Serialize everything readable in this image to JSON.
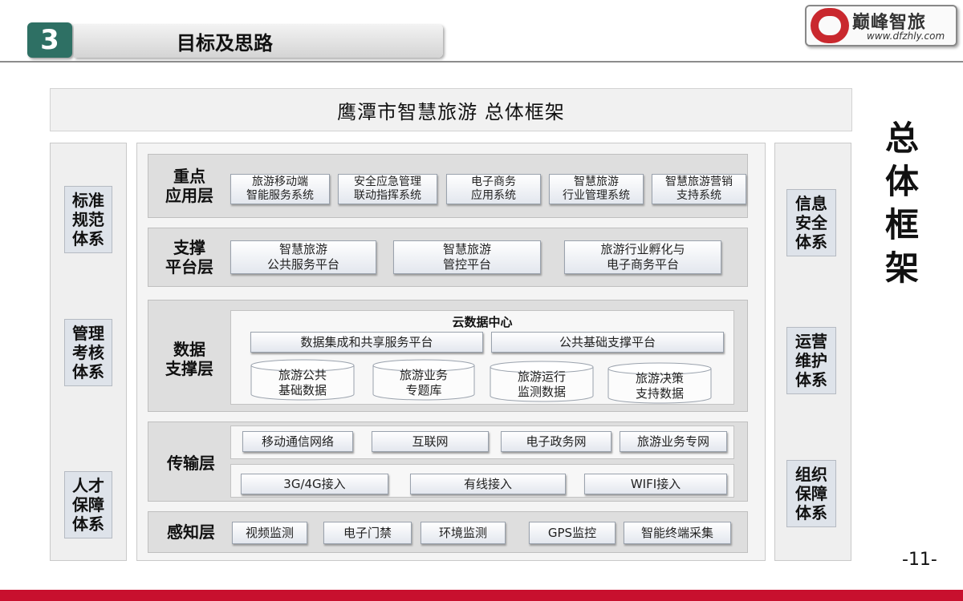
{
  "header": {
    "section_number": "3",
    "section_title": "目标及思路",
    "logo_text": "巅峰智旅",
    "logo_url": "www.dfzhly.com"
  },
  "diagram": {
    "title": "鹰潭市智慧旅游  总体框架",
    "left_pillars": [
      "标准\n规范\n体系",
      "管理\n考核\n体系",
      "人才\n保障\n体系"
    ],
    "right_pillars": [
      "信息\n安全\n体系",
      "运营\n维护\n体系",
      "组织\n保障\n体系"
    ],
    "layers": {
      "application": {
        "label": "重点\n应用层",
        "items": [
          "旅游移动端\n智能服务系统",
          "安全应急管理\n联动指挥系统",
          "电子商务\n应用系统",
          "智慧旅游\n行业管理系统",
          "智慧旅游营销\n支持系统"
        ]
      },
      "platform": {
        "label": "支撑\n平台层",
        "items": [
          "智慧旅游\n公共服务平台",
          "智慧旅游\n管控平台",
          "旅游行业孵化与\n电子商务平台"
        ]
      },
      "data": {
        "label": "数据\n支撑层",
        "cloud_title": "云数据中心",
        "platforms": [
          "数据集成和共享服务平台",
          "公共基础支撑平台"
        ],
        "databases": [
          "旅游公共\n基础数据",
          "旅游业务\n专题库",
          "旅游运行\n监测数据",
          "旅游决策\n支持数据"
        ]
      },
      "transport": {
        "label": "传输层",
        "networks": [
          "移动通信网络",
          "互联网",
          "电子政务网",
          "旅游业务专网"
        ],
        "access": [
          "3G/4G接入",
          "有线接入",
          "WIFI接入"
        ]
      },
      "perception": {
        "label": "感知层",
        "items": [
          "视频监测",
          "电子门禁",
          "环境监测",
          "GPS监控",
          "智能终端采集"
        ]
      }
    },
    "side_title": "总\n体\n框\n架"
  },
  "page_number": "-11-"
}
